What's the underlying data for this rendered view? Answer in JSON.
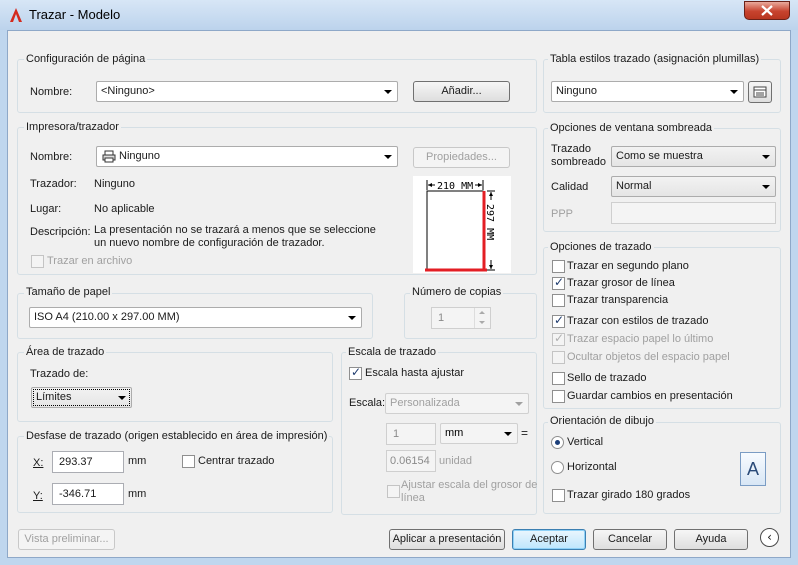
{
  "window": {
    "title": "Trazar - Modelo",
    "close_icon": "close-icon",
    "app_icon": "autocad-icon"
  },
  "page_setup": {
    "group_label": "Configuración de página",
    "name_label": "Nombre:",
    "name_value": "<Ninguno>",
    "add_button": "Añadir..."
  },
  "printer": {
    "group_label": "Impresora/trazador",
    "name_label": "Nombre:",
    "name_value": "Ninguno",
    "properties_button": "Propiedades...",
    "plotter_label": "Trazador:",
    "plotter_value": "Ninguno",
    "where_label": "Lugar:",
    "where_value": "No aplicable",
    "description_label": "Descripción:",
    "description_line1": "La presentación no se trazará a menos que se seleccione",
    "description_line2": "un nuevo nombre de configuración de trazador.",
    "plot_to_file": "Trazar en archivo",
    "plot_to_file_checked": false,
    "preview_width": "210 MM",
    "preview_height": "297 MM"
  },
  "paper_size": {
    "group_label": "Tamaño de papel",
    "value": "ISO A4 (210.00 x 297.00 MM)"
  },
  "copies": {
    "group_label": "Número de copias",
    "value": "1"
  },
  "plot_area": {
    "group_label": "Área de trazado",
    "what_label": "Trazado de:",
    "what_value": "Límites"
  },
  "plot_offset": {
    "group_label": "Desfase de trazado (origen establecido en área de impresión)",
    "x_label": "X:",
    "x_value": "293.37",
    "x_unit": "mm",
    "y_label": "Y:",
    "y_value": "-346.71",
    "y_unit": "mm",
    "center_label": "Centrar trazado",
    "center_checked": false
  },
  "plot_scale": {
    "group_label": "Escala de trazado",
    "fit_label": "Escala hasta ajustar",
    "fit_checked": true,
    "scale_label": "Escala:",
    "scale_value": "Personalizada",
    "value1": "1",
    "unit_value": "mm",
    "equals": "=",
    "value2": "0.06154",
    "unit_label": "unidad",
    "lineweights_line1": "Ajustar escala del grosor de",
    "lineweights_line2": "línea",
    "lineweights_checked": false
  },
  "plot_style_table": {
    "group_label": "Tabla estilos trazado (asignación plumillas)",
    "value": "Ninguno",
    "edit_icon": "edit-table-icon"
  },
  "shaded_viewport": {
    "group_label": "Opciones de ventana sombreada",
    "shade_label_line1": "Trazado",
    "shade_label_line2": "sombreado",
    "shade_value": "Como se muestra",
    "quality_label": "Calidad",
    "quality_value": "Normal",
    "dpi_label": "PPP"
  },
  "plot_options": {
    "group_label": "Opciones de trazado",
    "items": [
      {
        "label": "Trazar en segundo plano",
        "checked": false,
        "disabled": false
      },
      {
        "label": "Trazar grosor de línea",
        "checked": true,
        "disabled": false
      },
      {
        "label": "Trazar transparencia",
        "checked": false,
        "disabled": false
      },
      {
        "label": "Trazar con estilos de trazado",
        "checked": true,
        "disabled": false
      },
      {
        "label": "Trazar espacio papel lo último",
        "checked": true,
        "disabled": true
      },
      {
        "label": "Ocultar objetos del espacio papel",
        "checked": false,
        "disabled": true
      },
      {
        "label": "Sello de trazado",
        "checked": false,
        "disabled": false
      },
      {
        "label": "Guardar cambios en presentación",
        "checked": false,
        "disabled": false
      }
    ]
  },
  "orientation": {
    "group_label": "Orientación de dibujo",
    "portrait": "Vertical",
    "landscape": "Horizontal",
    "selected": "Vertical",
    "upside_down": "Trazar girado 180 grados",
    "upside_down_checked": false,
    "preview_glyph": "A"
  },
  "footer": {
    "preview": "Vista preliminar...",
    "apply": "Aplicar a presentación",
    "ok": "Aceptar",
    "cancel": "Cancelar",
    "help": "Ayuda",
    "collapse_glyph": "‹"
  },
  "colors": {
    "accent_red": "#e31e24",
    "title_bg": "#cddff3"
  }
}
